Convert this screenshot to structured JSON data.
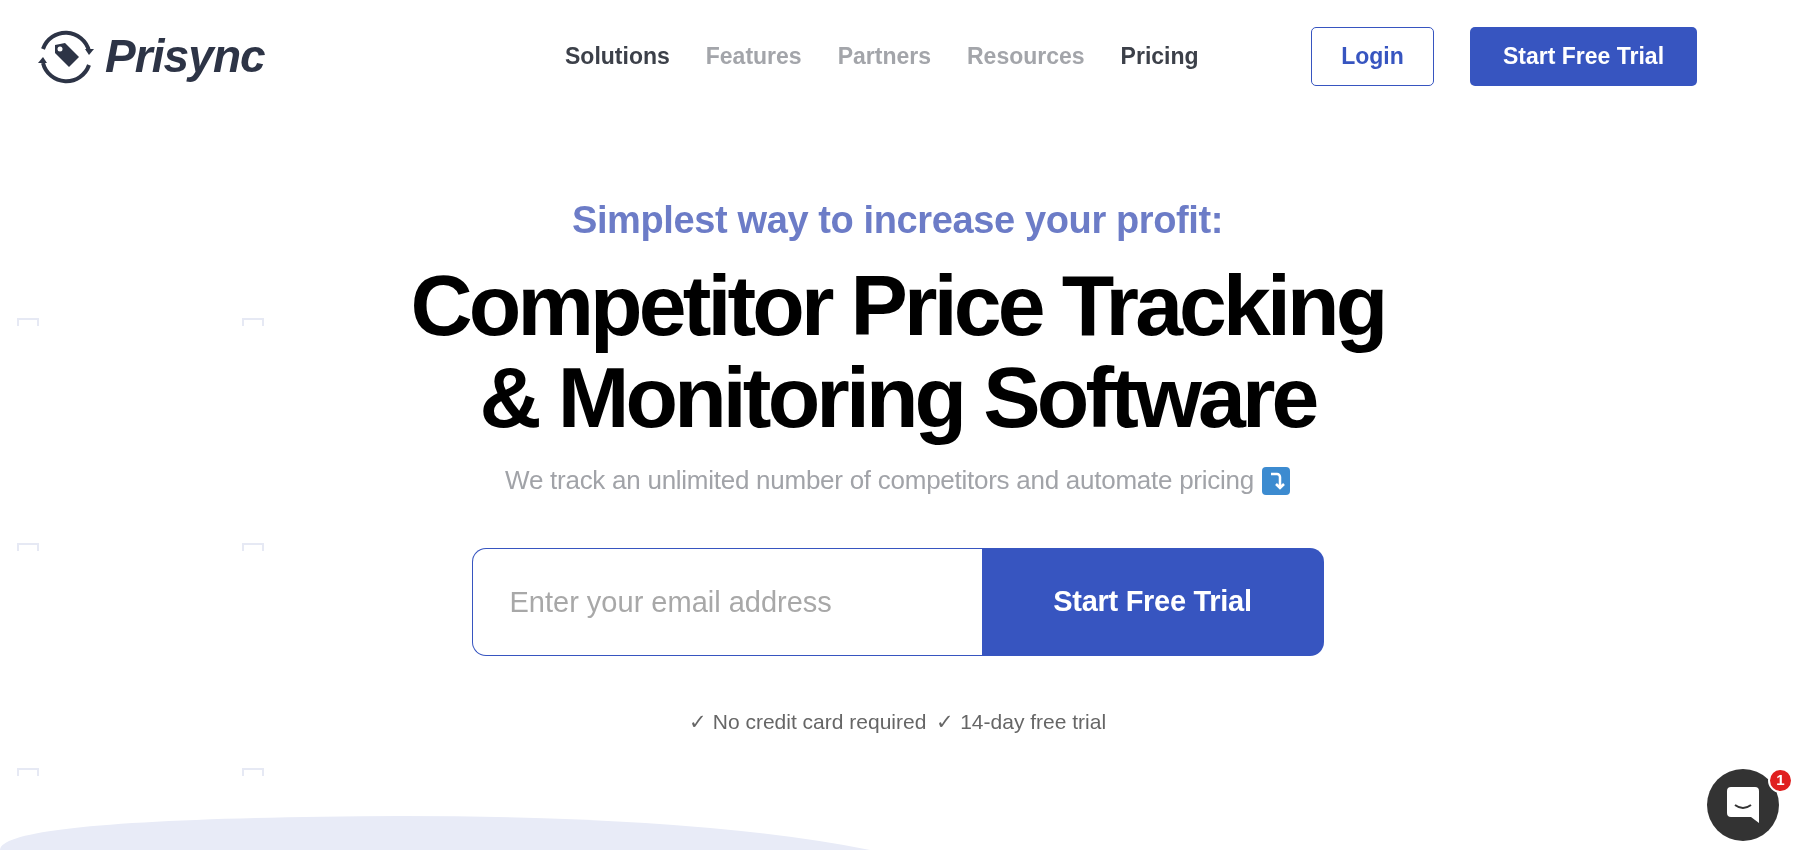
{
  "header": {
    "logo": "Prisync",
    "nav": [
      {
        "label": "Solutions",
        "emphasized": true
      },
      {
        "label": "Features",
        "emphasized": false
      },
      {
        "label": "Partners",
        "emphasized": false
      },
      {
        "label": "Resources",
        "emphasized": false
      },
      {
        "label": "Pricing",
        "emphasized": true
      }
    ],
    "login": "Login",
    "cta": "Start Free Trial"
  },
  "hero": {
    "eyebrow": "Simplest way to increase your profit:",
    "title_lines": [
      "Competitor Price Tracking",
      "& Monitoring Software"
    ],
    "tagline": "We track an unlimited number of competitors and automate pricing",
    "email": {
      "placeholder": "Enter your email address"
    },
    "submit": "Start Free Trial",
    "perks": [
      "✓ No credit card required",
      "✓ 14-day free trial"
    ]
  },
  "chat": {
    "badge": "1"
  }
}
